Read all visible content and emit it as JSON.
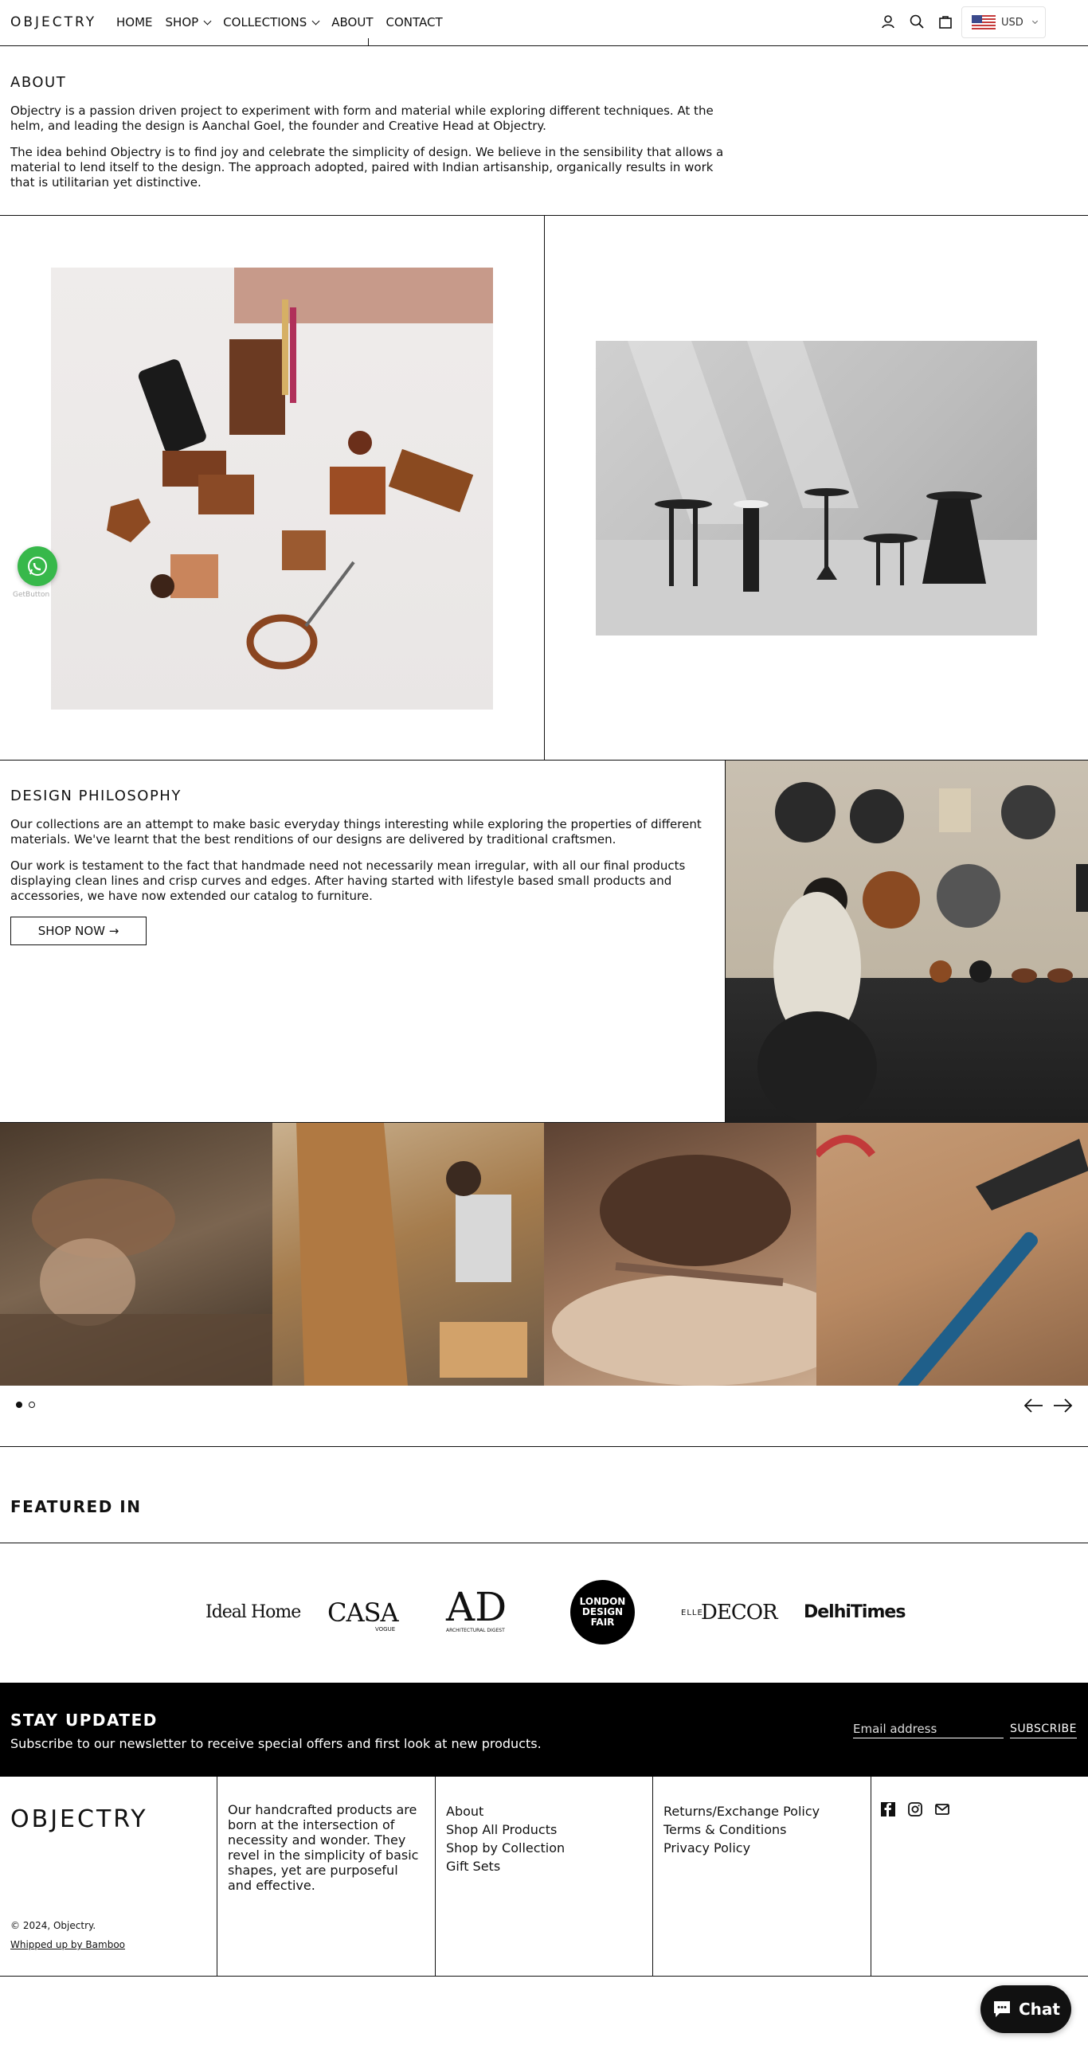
{
  "header": {
    "logo": "OBJECTRY",
    "nav": [
      {
        "label": "HOME"
      },
      {
        "label": "SHOP"
      },
      {
        "label": "COLLECTIONS"
      },
      {
        "label": "ABOUT"
      },
      {
        "label": "CONTACT"
      }
    ],
    "currency": "USD"
  },
  "about": {
    "title": "ABOUT",
    "p1": "Objectry is a passion driven project to experiment with form and material while exploring different techniques. At the helm, and leading the design is Aanchal Goel, the founder and Creative Head at Objectry.",
    "p2": "The idea behind Objectry is to find joy and celebrate the simplicity of design. We believe in the sensibility that allows a material to lend itself to the design. The approach adopted, paired with Indian artisanship, organically results in work that is utilitarian yet distinctive."
  },
  "whatsapp": {
    "caption": "GetButton"
  },
  "philosophy": {
    "title": "DESIGN PHILOSOPHY",
    "p1": "Our collections are an attempt to make basic everyday things interesting while exploring the properties of different materials. We've learnt that the best renditions of our designs are delivered by traditional craftsmen.",
    "p2": "Our work is testament to the fact that handmade need not necessarily mean irregular, with all our final products displaying clean lines and crisp curves and edges. After having started with lifestyle based small products and accessories, we have now extended our catalog to furniture.",
    "button": "SHOP NOW →"
  },
  "carousel": {
    "dots": 2,
    "active": 1
  },
  "featured": {
    "title": "FEATURED IN",
    "logos": [
      "Ideal Home",
      "CASA",
      "VOGUE",
      "AD",
      "ARCHITECTURAL DIGEST",
      "LONDON DESIGN FAIR",
      "ELLE",
      "DECOR",
      "DelhiTimes"
    ]
  },
  "newsletter": {
    "title": "STAY UPDATED",
    "subtitle": "Subscribe to our newsletter to receive special offers and first look at new products.",
    "placeholder": "Email address",
    "button": "SUBSCRIBE"
  },
  "footer": {
    "logo": "OBJECTRY",
    "copyright": "© 2024, Objectry.",
    "credit": "Whipped up by Bamboo",
    "description": "Our handcrafted products are born at the intersection of necessity and wonder. They revel in the simplicity of basic shapes, yet are purposeful and effective.",
    "links1": [
      "About",
      "Shop All Products",
      "Shop by Collection",
      "Gift Sets"
    ],
    "links2": [
      "Returns/Exchange Policy",
      "Terms & Conditions",
      "Privacy Policy"
    ]
  },
  "chat": {
    "label": "Chat"
  }
}
